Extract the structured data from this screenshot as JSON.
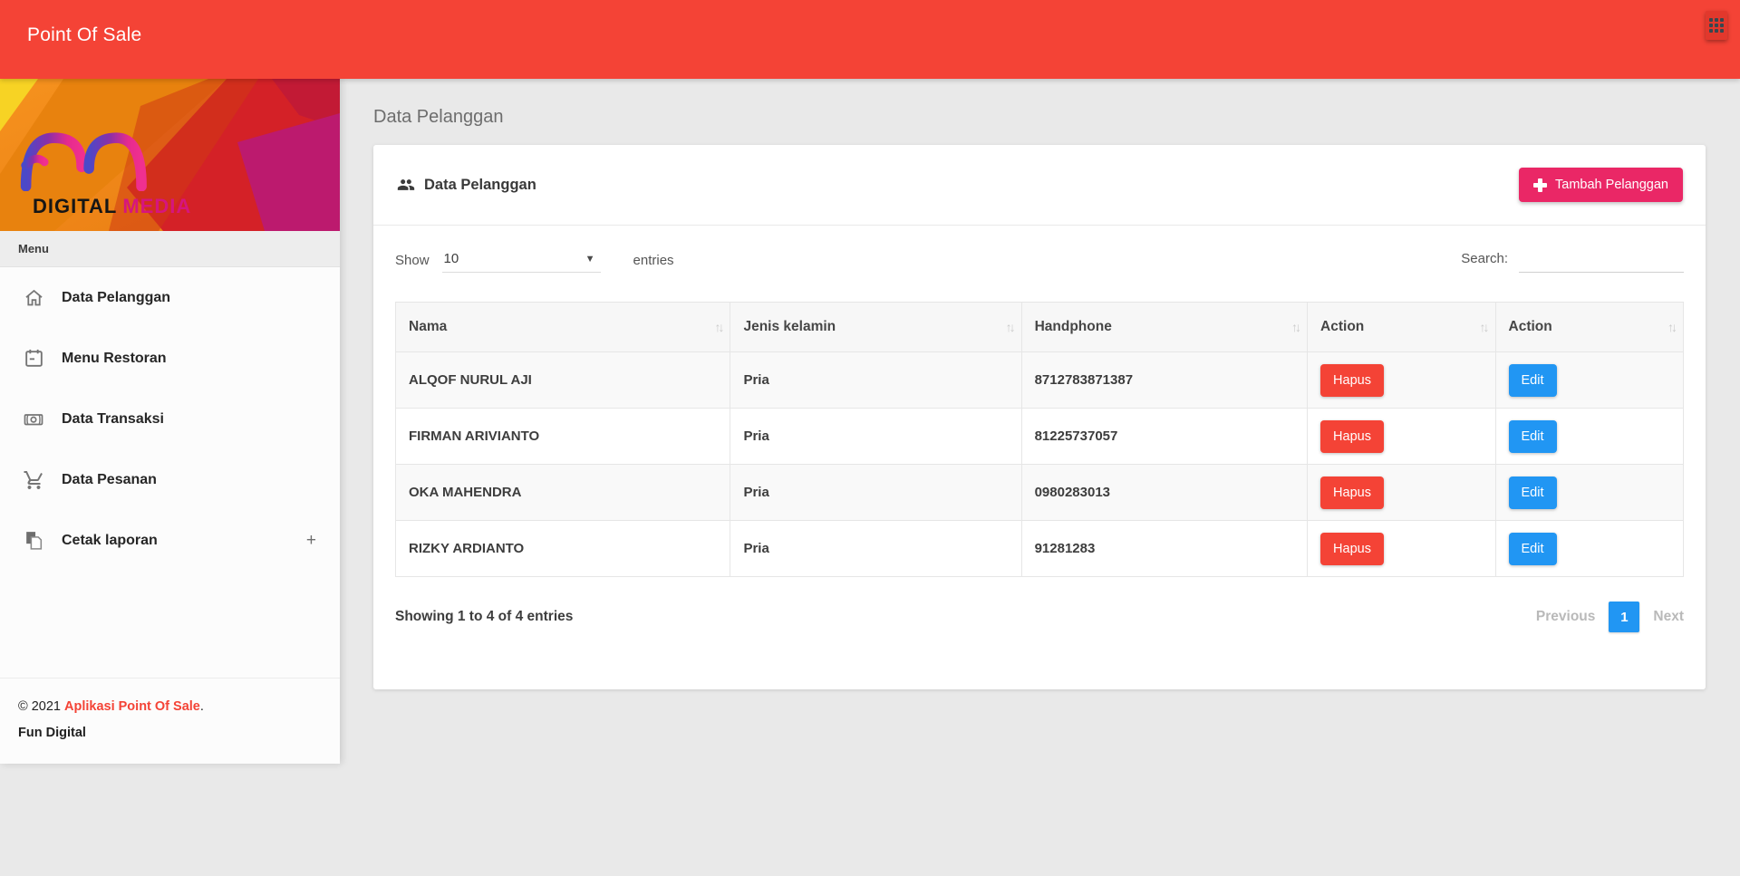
{
  "navbar": {
    "title": "Point Of Sale"
  },
  "sidebar": {
    "logo": {
      "line1": "DIGITAL",
      "line2": "MEDIA"
    },
    "menu_label": "Menu",
    "items": [
      {
        "label": "Data Pelanggan",
        "icon": "home-icon"
      },
      {
        "label": "Menu Restoran",
        "icon": "calendar-icon"
      },
      {
        "label": "Data Transaksi",
        "icon": "money-icon"
      },
      {
        "label": "Data Pesanan",
        "icon": "cart-icon"
      },
      {
        "label": "Cetak laporan",
        "icon": "report-icon",
        "expand": "+"
      }
    ],
    "footer": {
      "copyright_prefix": "© 2021 ",
      "copyright_link": "Aplikasi Point Of Sale",
      "copyright_suffix": ".",
      "brand": "Fun Digital"
    }
  },
  "main": {
    "page_title": "Data Pelanggan",
    "card": {
      "title": "Data Pelanggan",
      "add_button_label": "Tambah Pelanggan",
      "toolbar": {
        "show_label": "Show",
        "page_length": "10",
        "entries_label": "entries",
        "search_label": "Search:",
        "search_value": ""
      },
      "table": {
        "columns": [
          "Nama",
          "Jenis kelamin",
          "Handphone",
          "Action",
          "Action"
        ],
        "rows": [
          {
            "nama": "ALQOF NURUL AJI",
            "jenis_kelamin": "Pria",
            "handphone": "8712783871387",
            "hapus": "Hapus",
            "edit": "Edit"
          },
          {
            "nama": "FIRMAN ARIVIANTO",
            "jenis_kelamin": "Pria",
            "handphone": "81225737057",
            "hapus": "Hapus",
            "edit": "Edit"
          },
          {
            "nama": "OKA MAHENDRA",
            "jenis_kelamin": "Pria",
            "handphone": "0980283013",
            "hapus": "Hapus",
            "edit": "Edit"
          },
          {
            "nama": "RIZKY ARDIANTO",
            "jenis_kelamin": "Pria",
            "handphone": "91281283",
            "hapus": "Hapus",
            "edit": "Edit"
          }
        ]
      },
      "footer": {
        "info": "Showing 1 to 4 of 4 entries",
        "previous_label": "Previous",
        "current_page": "1",
        "next_label": "Next"
      }
    }
  },
  "colors": {
    "navbar_red": "#f44336",
    "accent_pink": "#ea2766",
    "hapus_red": "#f44336",
    "edit_blue": "#2196f3",
    "pagination_active_blue": "#2196f3",
    "page_background": "#e9e9e9"
  }
}
